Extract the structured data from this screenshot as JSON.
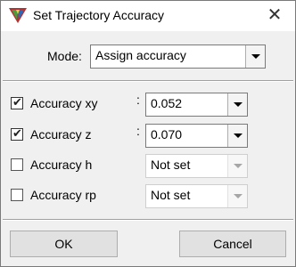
{
  "window": {
    "title": "Set Trajectory Accuracy",
    "close_glyph": "✕"
  },
  "mode": {
    "label": "Mode:",
    "selected": "Assign accuracy"
  },
  "fields": [
    {
      "label": "Accuracy xy",
      "checked": true,
      "colon": ":",
      "value": "0.052",
      "enabled": true
    },
    {
      "label": "Accuracy z",
      "checked": true,
      "colon": ":",
      "value": "0.070",
      "enabled": true
    },
    {
      "label": "Accuracy h",
      "checked": false,
      "colon": "",
      "value": "Not set",
      "enabled": false
    },
    {
      "label": "Accuracy rp",
      "checked": false,
      "colon": "",
      "value": "Not set",
      "enabled": false
    }
  ],
  "buttons": {
    "ok": "OK",
    "cancel": "Cancel"
  },
  "icons": {
    "app": "trajectory-triangle-icon",
    "checkmark": "✔"
  }
}
